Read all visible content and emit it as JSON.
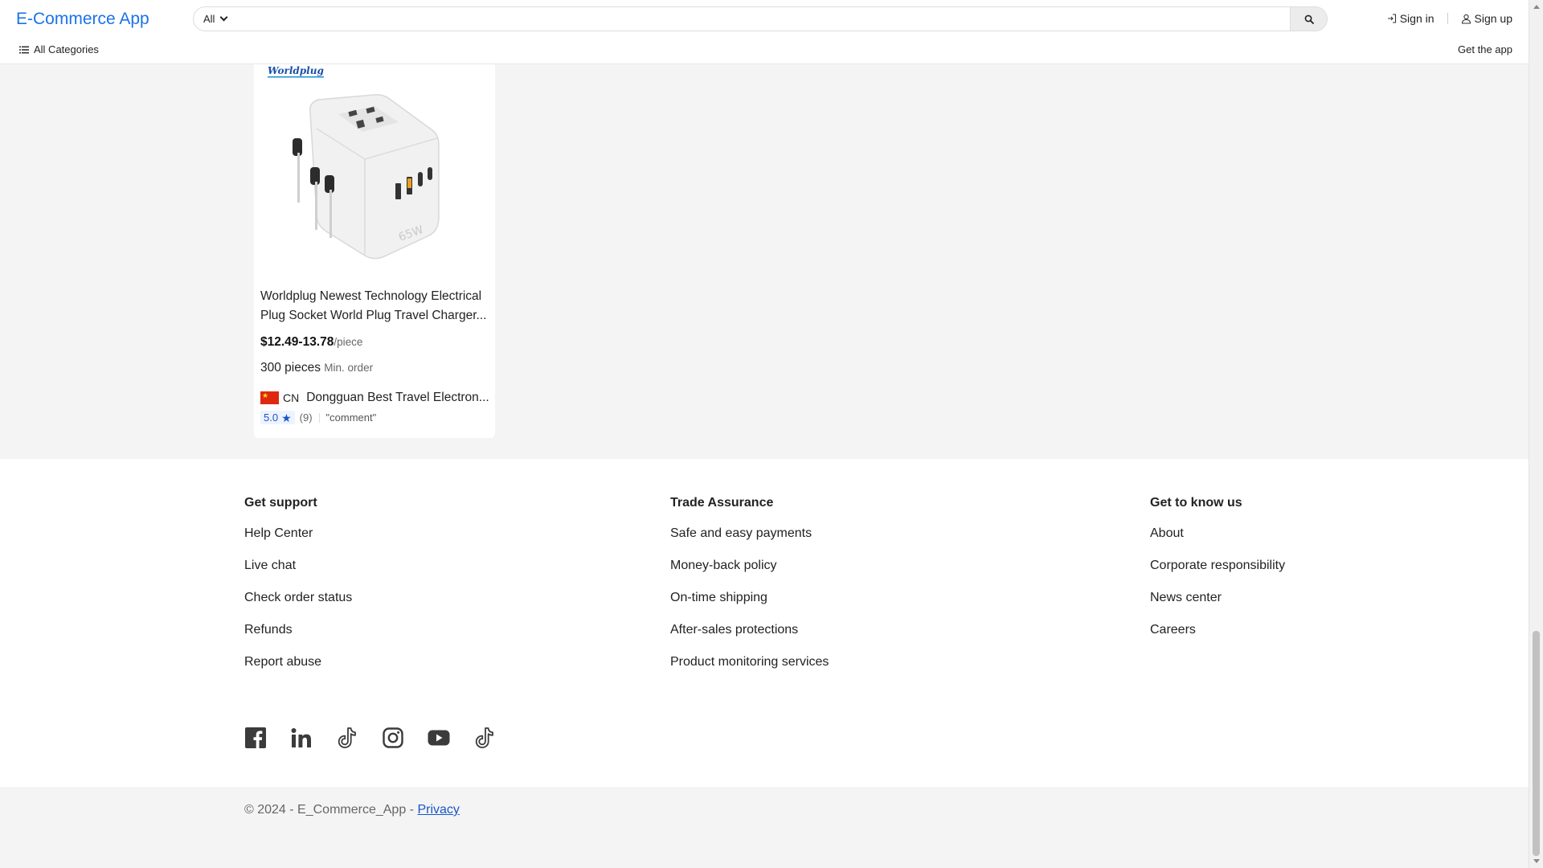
{
  "header": {
    "brand": "E-Commerce App",
    "search_category": "All",
    "search_placeholder": "",
    "sign_in": "Sign in",
    "sign_up": "Sign up",
    "all_categories": "All Categories",
    "get_app": "Get the app"
  },
  "product": {
    "brand_logo": "Worldplug",
    "title_line1": "Worldplug Newest Technology Electrical",
    "title_line2": "Plug Socket World Plug Travel Charger...",
    "price": "$12.49-13.78",
    "price_unit": "/piece",
    "moq_value": "300 pieces",
    "moq_label": "Min. order",
    "country_code": "CN",
    "supplier": "Dongguan Best Travel Electron...",
    "rating": "5.0",
    "review_count": "(9)",
    "comment": "\"comment\""
  },
  "footer": {
    "support": {
      "heading": "Get support",
      "links": [
        "Help Center",
        "Live chat",
        "Check order status",
        "Refunds",
        "Report abuse"
      ]
    },
    "trade": {
      "heading": "Trade Assurance",
      "links": [
        "Safe and easy payments",
        "Money-back policy",
        "On-time shipping",
        "After-sales protections",
        "Product monitoring services"
      ]
    },
    "about": {
      "heading": "Get to know us",
      "links": [
        "About",
        "Corporate responsibility",
        "News center",
        "Careers"
      ]
    },
    "social_icons": [
      "facebook-icon",
      "linkedin-icon",
      "tiktok-icon",
      "instagram-icon",
      "youtube-icon",
      "tiktok-icon"
    ],
    "copyright": "© 2024 - E_Commerce_App - ",
    "privacy": "Privacy"
  },
  "colors": {
    "brand": "#1a73e8",
    "link": "#1a56c8",
    "page_bg": "#f4f4f4"
  }
}
